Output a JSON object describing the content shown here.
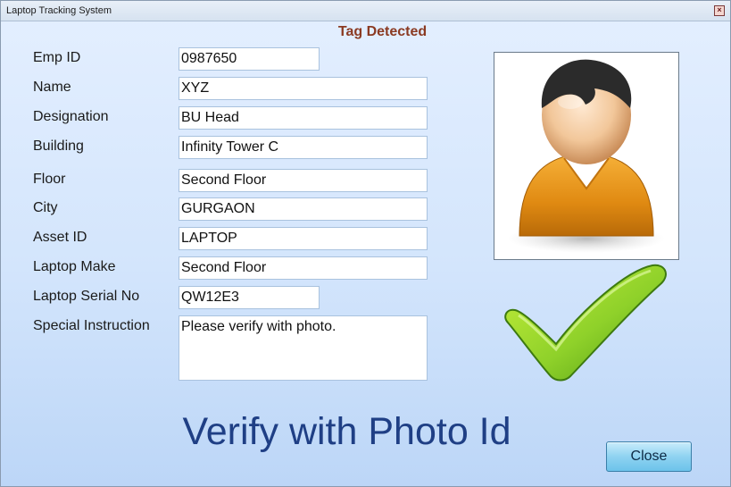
{
  "window": {
    "title": "Laptop Tracking System"
  },
  "status": "Tag Detected",
  "fields": [
    {
      "label": "Emp ID",
      "value": "0987650"
    },
    {
      "label": "Name",
      "value": "XYZ"
    },
    {
      "label": "Designation",
      "value": "BU Head"
    },
    {
      "label": "Building",
      "value": "Infinity Tower C"
    },
    {
      "label": "Floor",
      "value": "Second Floor"
    },
    {
      "label": "City",
      "value": "GURGAON"
    },
    {
      "label": "Asset ID",
      "value": "LAPTOP"
    },
    {
      "label": "Laptop Make",
      "value": "Second Floor"
    },
    {
      "label": "Laptop Serial No",
      "value": "QW12E3"
    },
    {
      "label": "Special Instruction",
      "value": "Please verify with photo."
    }
  ],
  "photo": {
    "icon": "user-avatar-icon"
  },
  "verified_icon": "checkmark-icon",
  "banner": "Verify with Photo Id",
  "close_button": "Close",
  "colors": {
    "status": "#8b3a22",
    "banner": "#1f3f85",
    "check": "#8fd12a"
  }
}
